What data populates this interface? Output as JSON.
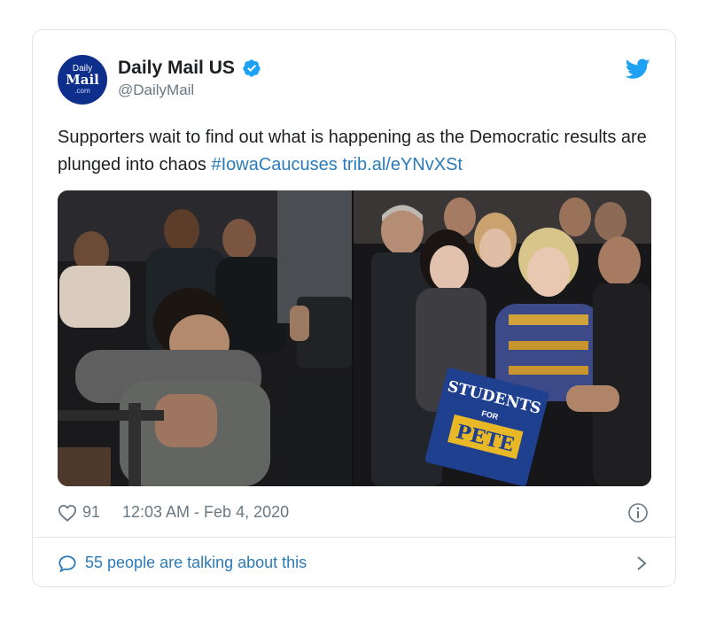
{
  "account": {
    "display_name": "Daily Mail US",
    "handle": "@DailyMail",
    "avatar": {
      "line1": "Daily",
      "line2": "Mail",
      "line3": ".com"
    },
    "verified_icon": "verified-badge-icon",
    "platform_icon": "twitter-bird-icon"
  },
  "tweet": {
    "text": "Supporters wait to find out what is happening as the Democratic results are plunged into chaos",
    "hashtag": "#IowaCaucuses",
    "link": "trib.al/eYNvXSt"
  },
  "media": {
    "sign_text": {
      "line1": "STUDENTS",
      "line2": "FOR",
      "line3": "PETE"
    }
  },
  "meta": {
    "likes": "91",
    "timestamp": "12:03 AM - Feb 4, 2020",
    "heart_icon": "heart-icon",
    "info_icon": "info-icon"
  },
  "footer": {
    "talking_label": "55 people are talking about this",
    "bubble_icon": "speech-bubble-icon",
    "chevron_icon": "chevron-right-icon"
  },
  "colors": {
    "link": "#2b7bb9",
    "verified": "#1da1f2",
    "muted": "#697882",
    "border": "#e1e8ed",
    "avatar_bg": "#0e2e8c"
  }
}
